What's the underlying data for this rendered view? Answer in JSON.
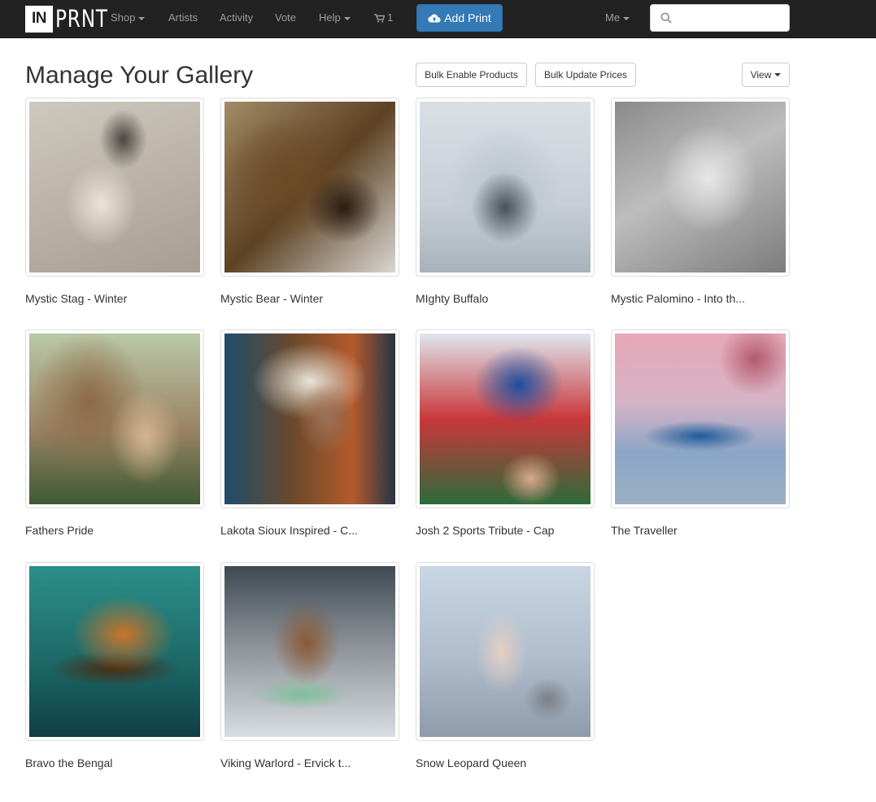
{
  "nav": {
    "logo_box": "IN",
    "logo_text": "PRNT",
    "shop": "Shop",
    "artists": "Artists",
    "activity": "Activity",
    "vote": "Vote",
    "help": "Help",
    "cart_count": "1",
    "add_print": "Add Print",
    "me": "Me",
    "search_placeholder": ""
  },
  "header": {
    "title": "Manage Your Gallery",
    "bulk_enable": "Bulk Enable Products",
    "bulk_update": "Bulk Update Prices",
    "view": "View"
  },
  "gallery": [
    {
      "title": "Mystic Stag - Winter"
    },
    {
      "title": "Mystic Bear - Winter"
    },
    {
      "title": "MIghty Buffalo"
    },
    {
      "title": "Mystic Palomino - Into th..."
    },
    {
      "title": "Fathers Pride"
    },
    {
      "title": "Lakota Sioux Inspired - C..."
    },
    {
      "title": "Josh 2 Sports Tribute - Cap"
    },
    {
      "title": "The Traveller"
    },
    {
      "title": "Bravo the Bengal"
    },
    {
      "title": "Viking Warlord - Ervick t..."
    },
    {
      "title": "Snow Leopard Queen"
    }
  ],
  "colors": {
    "navbar": "#222222",
    "primary": "#337ab7",
    "nav_text": "#9d9d9d"
  }
}
